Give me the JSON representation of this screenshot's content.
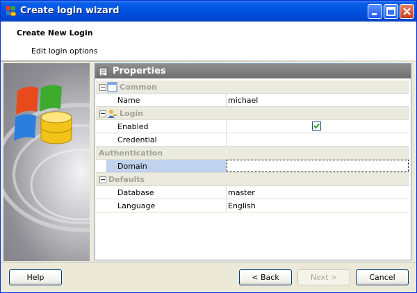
{
  "window": {
    "title": "Create login wizard"
  },
  "header": {
    "title": "Create New Login",
    "subtitle": "Edit login options"
  },
  "grid": {
    "title": "Properties",
    "sections": [
      {
        "name": "Common",
        "icon": "window-icon",
        "rows": [
          {
            "name": "Name",
            "value": "michael"
          }
        ]
      },
      {
        "name": "Login",
        "icon": "user-key-icon",
        "rows": [
          {
            "name": "Enabled",
            "checked": true
          },
          {
            "name": "Credential",
            "value": ""
          }
        ]
      },
      {
        "name": "Authentication",
        "rows": [
          {
            "name": "Domain",
            "value": "",
            "selected": true
          }
        ]
      },
      {
        "name": "Defaults",
        "rows": [
          {
            "name": "Database",
            "value": "master"
          },
          {
            "name": "Language",
            "value": "English"
          }
        ]
      }
    ]
  },
  "buttons": {
    "help": "Help",
    "back": "< Back",
    "next": "Next >",
    "cancel": "Cancel"
  },
  "colors": {
    "titlebar": "#0054e3",
    "selection": "#c1d2ee",
    "category": "#ebeade",
    "grid_header": "#7a7a7a"
  }
}
